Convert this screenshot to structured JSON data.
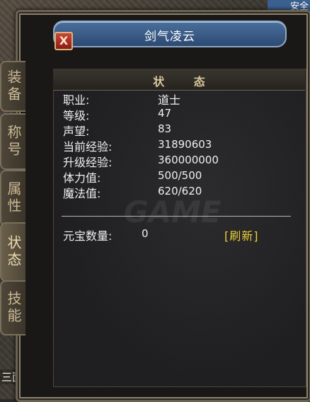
{
  "window": {
    "title": "剑气凌云",
    "close_label": "X",
    "header": "状 态"
  },
  "corner_text": "安全",
  "bottom_left_text": "三面",
  "tabs": [
    {
      "label": "装备",
      "active": false
    },
    {
      "label": "称号",
      "active": false
    },
    {
      "label": "属性",
      "active": false
    },
    {
      "label": "状态",
      "active": true
    },
    {
      "label": "技能",
      "active": false
    }
  ],
  "stats": [
    {
      "label": "职业:",
      "value": "道士"
    },
    {
      "label": "等级:",
      "value": "47"
    },
    {
      "label": "声望:",
      "value": "83"
    },
    {
      "label": "当前经验:",
      "value": "31890603"
    },
    {
      "label": "升级经验:",
      "value": "360000000"
    },
    {
      "label": "体力值:",
      "value": "500/500"
    },
    {
      "label": "魔法值:",
      "value": "620/620"
    }
  ],
  "yuanbao": {
    "label": "元宝数量:",
    "value": "0",
    "refresh_label": "[刷新]"
  }
}
